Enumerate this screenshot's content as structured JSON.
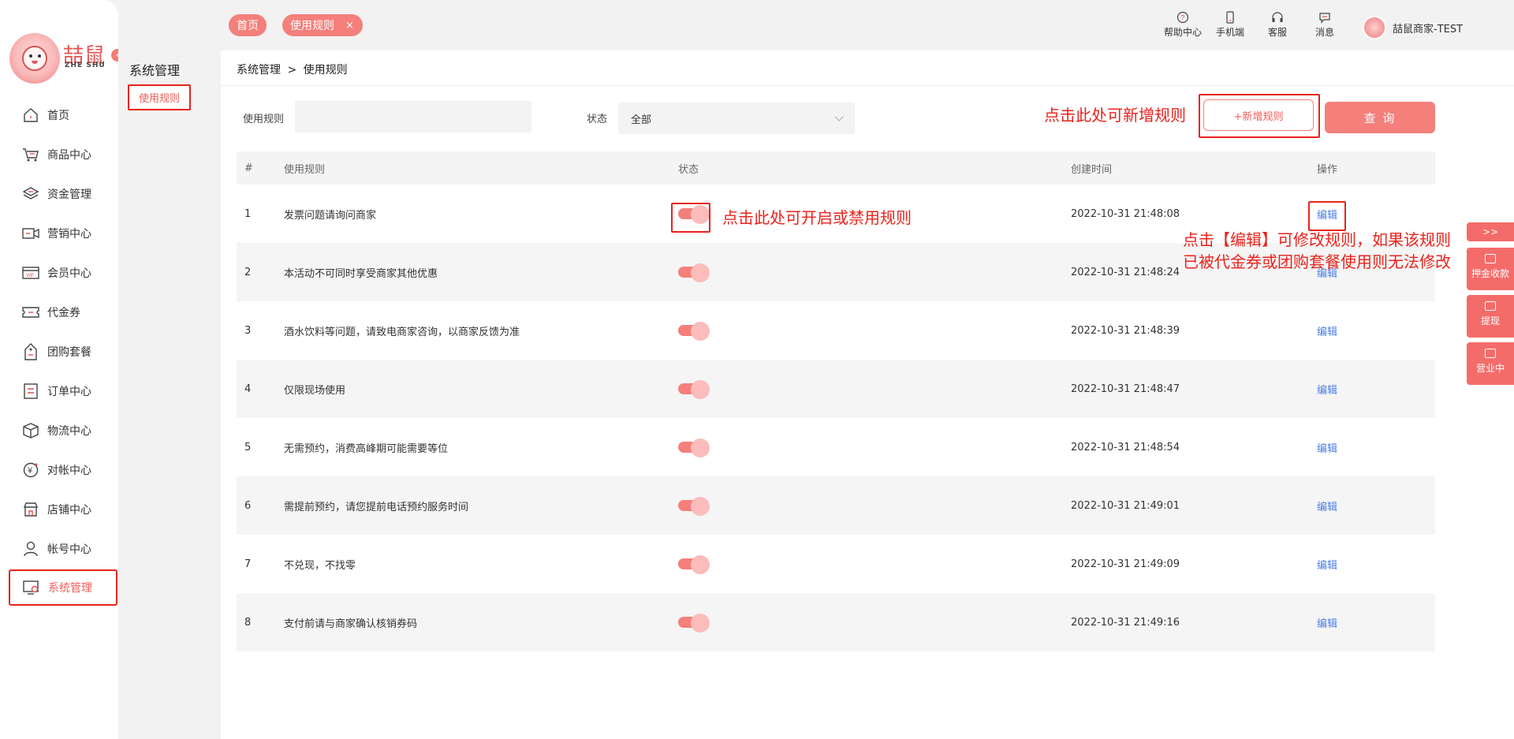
{
  "logo": {
    "word": "喆鼠",
    "sub": "ZHE SHU"
  },
  "sidebar": {
    "items": [
      {
        "label": "首页",
        "icon": "home-icon"
      },
      {
        "label": "商品中心",
        "icon": "cart-icon"
      },
      {
        "label": "资金管理",
        "icon": "layers-icon"
      },
      {
        "label": "营销中心",
        "icon": "video-icon"
      },
      {
        "label": "会员中心",
        "icon": "vip-card-icon"
      },
      {
        "label": "代金券",
        "icon": "ticket-icon"
      },
      {
        "label": "团购套餐",
        "icon": "tag-icon"
      },
      {
        "label": "订单中心",
        "icon": "list-doc-icon"
      },
      {
        "label": "物流中心",
        "icon": "box-icon"
      },
      {
        "label": "对帐中心",
        "icon": "yen-icon"
      },
      {
        "label": "店铺中心",
        "icon": "store-icon"
      },
      {
        "label": "帐号中心",
        "icon": "user-icon"
      },
      {
        "label": "系统管理",
        "icon": "settings-monitor-icon",
        "active": true
      }
    ]
  },
  "subnav": {
    "title": "系统管理",
    "item": "使用规则"
  },
  "topbar": {
    "tabs": [
      {
        "label": "首页"
      },
      {
        "label": "使用规则",
        "close": "×"
      }
    ],
    "tools": [
      {
        "label": "帮助中心",
        "icon": "help-icon"
      },
      {
        "label": "手机端",
        "icon": "phone-icon"
      },
      {
        "label": "客服",
        "icon": "headset-icon"
      },
      {
        "label": "消息",
        "icon": "message-icon"
      }
    ],
    "user": "喆鼠商家-TEST"
  },
  "breadcrumb": {
    "parent": "系统管理",
    "sep": ">",
    "current": "使用规则"
  },
  "filters": {
    "rule_label": "使用规则",
    "rule_value": "",
    "status_label": "状态",
    "status_value": "全部"
  },
  "buttons": {
    "add": "+新增规则",
    "query": "查 询"
  },
  "table": {
    "headers": [
      "#",
      "使用规则",
      "状态",
      "创建时间",
      "操作"
    ],
    "rows": [
      {
        "num": "1",
        "rule": "发票问题请询问商家",
        "time": "2022-10-31 21:48:08",
        "op": "编辑"
      },
      {
        "num": "2",
        "rule": "本活动不可同时享受商家其他优惠",
        "time": "2022-10-31 21:48:24",
        "op": "编辑"
      },
      {
        "num": "3",
        "rule": "酒水饮料等问题，请致电商家咨询，以商家反馈为准",
        "time": "2022-10-31 21:48:39",
        "op": "编辑"
      },
      {
        "num": "4",
        "rule": "仅限现场使用",
        "time": "2022-10-31 21:48:47",
        "op": "编辑"
      },
      {
        "num": "5",
        "rule": "无需预约，消费高峰期可能需要等位",
        "time": "2022-10-31 21:48:54",
        "op": "编辑"
      },
      {
        "num": "6",
        "rule": "需提前预约，请您提前电话预约服务时间",
        "time": "2022-10-31 21:49:01",
        "op": "编辑"
      },
      {
        "num": "7",
        "rule": "不兑现，不找零",
        "time": "2022-10-31 21:49:09",
        "op": "编辑"
      },
      {
        "num": "8",
        "rule": "支付前请与商家确认核销券码",
        "time": "2022-10-31 21:49:16",
        "op": "编辑"
      }
    ]
  },
  "annotations": {
    "add": "点击此处可新增规则",
    "toggle": "点击此处可开启或禁用规则",
    "edit_line1": "点击【编辑】可修改规则，如果该规则",
    "edit_line2": "已被代金券或团购套餐使用则无法修改"
  },
  "float_panel": {
    "expand": ">>",
    "items": [
      {
        "label": "押金收款"
      },
      {
        "label": "提现"
      },
      {
        "label": "营业中"
      }
    ]
  },
  "colors": {
    "accent": "#f47f7b",
    "annotation": "#e8231d",
    "link": "#4a7de6"
  }
}
